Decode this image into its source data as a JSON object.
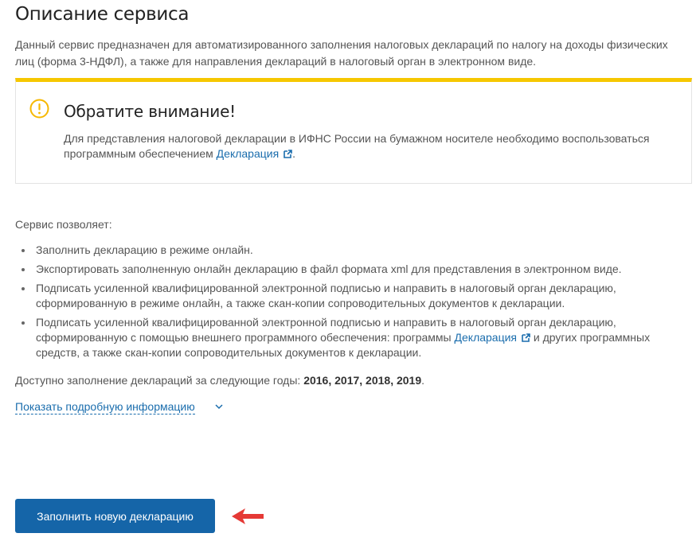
{
  "page": {
    "title": "Описание сервиса",
    "intro": "Данный сервис предназначен для автоматизированного заполнения налоговых деклараций по налогу на доходы физических лиц (форма 3-НДФЛ), а также для направления деклараций в налоговый орган в электронном виде."
  },
  "notice": {
    "icon": "warning-circle-icon",
    "accent_color": "#f6c700",
    "title": "Обратите внимание!",
    "text_before": "Для представления налоговой декларации в ИФНС России на бумажном носителе необходимо воспользоваться программным обеспечением ",
    "link_text": "Декларация",
    "text_after": "."
  },
  "features": {
    "heading": "Сервис позволяет:",
    "items": [
      "Заполнить декларацию в режиме онлайн.",
      "Экспортировать заполненную онлайн декларацию в файл формата xml для представления в электронном виде.",
      "Подписать усиленной квалифицированной электронной подписью и направить в налоговый орган декларацию, сформированную в режиме онлайн, а также скан-копии сопроводительных документов к декларации."
    ],
    "item4": {
      "text_before": "Подписать усиленной квалифицированной электронной подписью и направить в налоговый орган декларацию, сформированную с помощью внешнего программного обеспечения: программы ",
      "link_text": "Декларация",
      "text_after": " и других программных средств, а также скан-копии сопроводительных документов к декларации."
    }
  },
  "years": {
    "label": "Доступно заполнение деклараций за следующие годы: ",
    "values": "2016, 2017, 2018, 2019",
    "suffix": "."
  },
  "more_info": {
    "label": "Показать подробную информацию",
    "icon": "chevron-down-icon"
  },
  "actions": {
    "primary_label": "Заполнить новую декларацию",
    "primary_color": "#1565a8",
    "pointer_icon": "red-arrow-icon"
  },
  "colors": {
    "link": "#1a6dad",
    "arrow": "#e53935"
  }
}
